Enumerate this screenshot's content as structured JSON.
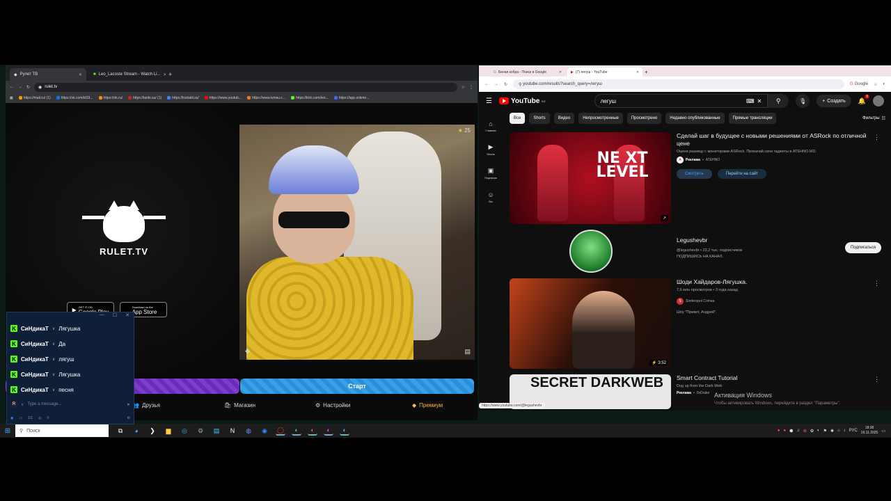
{
  "left_browser": {
    "tabs": [
      {
        "title": "Рулет ТВ",
        "active": true
      },
      {
        "title": "Leo_Lacoste Stream - Watch Li...",
        "active": false
      }
    ],
    "url": "rulet.tv",
    "bookmarks": [
      "https://mail.ru/ (1)",
      "https://vk.com/id19...",
      "https://ok.ru/",
      "https://tanki.su/ (1)",
      "https://lostabil.su/",
      "https://www.youtub...",
      "https://www.ivmsu.c...",
      "https://kick.com/leo...",
      "https://app.onlime..."
    ]
  },
  "rulet": {
    "brand": "RULET.TV",
    "google_play": "Google Play",
    "google_play_small": "GET IT ON",
    "app_store": "App Store",
    "app_store_small": "Download on the",
    "stars": "25",
    "start_button": "Старт",
    "nav": {
      "friends": "Друзья",
      "shop": "Магазин",
      "settings": "Настройки",
      "premium": "Премиум"
    }
  },
  "chat": {
    "messages": [
      {
        "user": "СиНдикаТ",
        "text": "Лягушка"
      },
      {
        "user": "СиНдикаТ",
        "text": "Да"
      },
      {
        "user": "СиНдикаТ",
        "text": "лягуш"
      },
      {
        "user": "СиНдикаТ",
        "text": "Лягушка"
      },
      {
        "user": "СиНдикаТ",
        "text": "песня"
      }
    ],
    "input_placeholder": "Type a message...",
    "avatar_letter": "R",
    "footer_count": "1/1",
    "footer_viewers": "0"
  },
  "right_browser": {
    "tabs": [
      {
        "title": "Белая кобра - Поиск в Google",
        "active": false
      },
      {
        "title": "(7) легуш - YouTube",
        "active": true
      }
    ],
    "url": "youtube.com/results?search_query=легуш",
    "google_label": "Google"
  },
  "youtube": {
    "logo": "YouTube",
    "region": "KZ",
    "query": "легуш",
    "create": "Создать",
    "notifications": "9",
    "sidebar": [
      {
        "icon": "⌂",
        "label": "Главная"
      },
      {
        "icon": "▶",
        "label": "Shorts"
      },
      {
        "icon": "▣",
        "label": "Подписки"
      },
      {
        "icon": "☺",
        "label": "Вы"
      }
    ],
    "chips": [
      "Все",
      "Shorts",
      "Видео",
      "Непросмотренные",
      "Просмотрено",
      "Недавно опубликованные",
      "Прямые трансляции"
    ],
    "filters": "Фильтры",
    "results": [
      {
        "title": "Сделай шаг в будущее с новыми решениями от ASRock по отличной цене",
        "meta": "Оцени разницу с мониторами ASRock. Прокачай свои гаджеты в ATEHNO.MD.",
        "ad_label": "Реклама",
        "advertiser": "ATEHNO",
        "btn_watch": "Смотреть",
        "btn_site": "Перейти на сайт",
        "thumb_text": "NE XT LEVEL"
      },
      {
        "title": "Legushevbr",
        "meta": "@legushevbr • 23,2 тыс. подписчиков",
        "meta2": "ПОДПИШИСЬ НА КАНАЛ.",
        "subscribe": "Подписаться"
      },
      {
        "title": "Шоди Хайдаров-Лягушка.",
        "meta": "7,6 млн просмотров • 3 года назад",
        "channel": "Simferopol Crimea",
        "desc": "Шоу \"Привет, Андрей\".",
        "duration": "3:52"
      },
      {
        "title": "Smart Contract Tutorial",
        "meta": "Dug up from the Dark Web",
        "ad_label": "Реклама",
        "advertiser": "0xDrake",
        "thumb_text": "SECRET DARKWEB"
      }
    ],
    "status_url": "https://www.youtube.com/@legushevbr"
  },
  "windows": {
    "activate_title": "Активация Windows",
    "activate_sub": "Чтобы активировать Windows, перейдите в раздел \"Параметры\".",
    "search": "Поиск",
    "lang": "РУС",
    "time": "18:38",
    "date": "16.11.2025"
  }
}
